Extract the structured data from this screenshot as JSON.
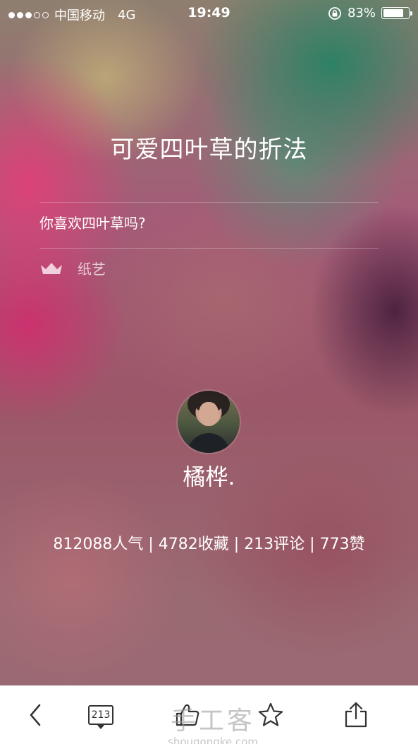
{
  "status_bar": {
    "carrier": "中国移动",
    "network": "4G",
    "time": "19:49",
    "battery": "83%",
    "battery_level": 0.83
  },
  "article": {
    "title": "可爱四叶草的折法",
    "description": "你喜欢四叶草吗?",
    "category": "纸艺"
  },
  "author": {
    "name": "橘桦."
  },
  "stats": "812088人气 | 4782收藏 | 213评论 | 773赞",
  "toolbar": {
    "comment_count": "213"
  },
  "watermark": {
    "main": "手工客",
    "sub": "shougongke.com"
  },
  "colors": {
    "text": "#ffffff",
    "toolbar_bg": "#ffffff",
    "toolbar_icon": "#333333"
  }
}
